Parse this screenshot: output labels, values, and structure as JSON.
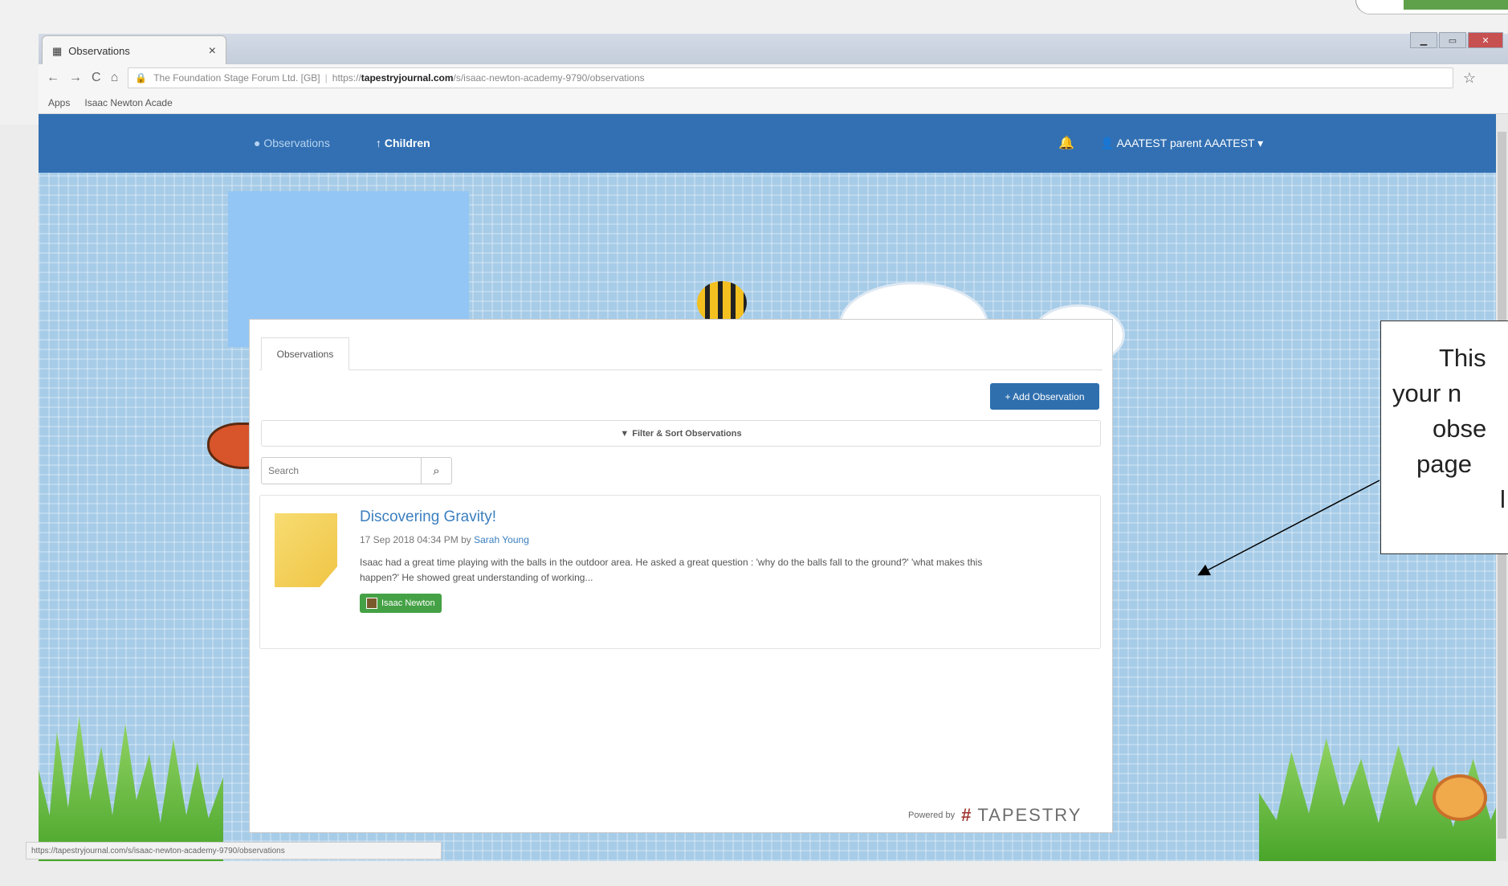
{
  "browser": {
    "tab_title": "Observations",
    "tab_close": "×",
    "nav_buttons": [
      "←",
      "→",
      "C",
      "⌂"
    ],
    "site_identity": "The Foundation Stage Forum Ltd. [GB]",
    "url_prefix": "https://",
    "url_host": "tapestryjournal.com",
    "url_path": "/s/isaac-newton-academy-9790/observations",
    "star": "☆",
    "bookmarks": [
      "Apps",
      "Isaac Newton Acade"
    ],
    "window_controls": [
      "▁",
      "▭",
      "✕"
    ],
    "status_url": "https://tapestryjournal.com/s/isaac-newton-academy-9790/observations"
  },
  "navbar": {
    "observations": "Observations",
    "children": "Children",
    "bell": "🔔",
    "user": "AAATEST parent AAATEST"
  },
  "panel": {
    "tab_label": "Observations",
    "add_button": "+ Add Observation",
    "filter_label": "Filter & Sort Observations",
    "search_placeholder": "Search",
    "search_icon": "⌕",
    "observation": {
      "title": "Discovering Gravity!",
      "date": "17 Sep 2018 04:34 PM by",
      "author": "Sarah Young",
      "body": "Isaac had a great time playing with the balls in the outdoor area. He asked a great question : 'why do the balls fall to the ground?' 'what makes this happen?' He showed great understanding of working...",
      "child_tag": "Isaac Newton"
    },
    "powered_by": "Powered by",
    "logo_text": "TAPESTRY"
  },
  "callout": {
    "lines": [
      "This",
      "your n",
      "obse",
      "page",
      "l"
    ]
  },
  "colors": {
    "navbar": "#3270b3",
    "accent": "#2f6fae",
    "badge": "#45a145",
    "page_bg": "#a7cce8"
  }
}
